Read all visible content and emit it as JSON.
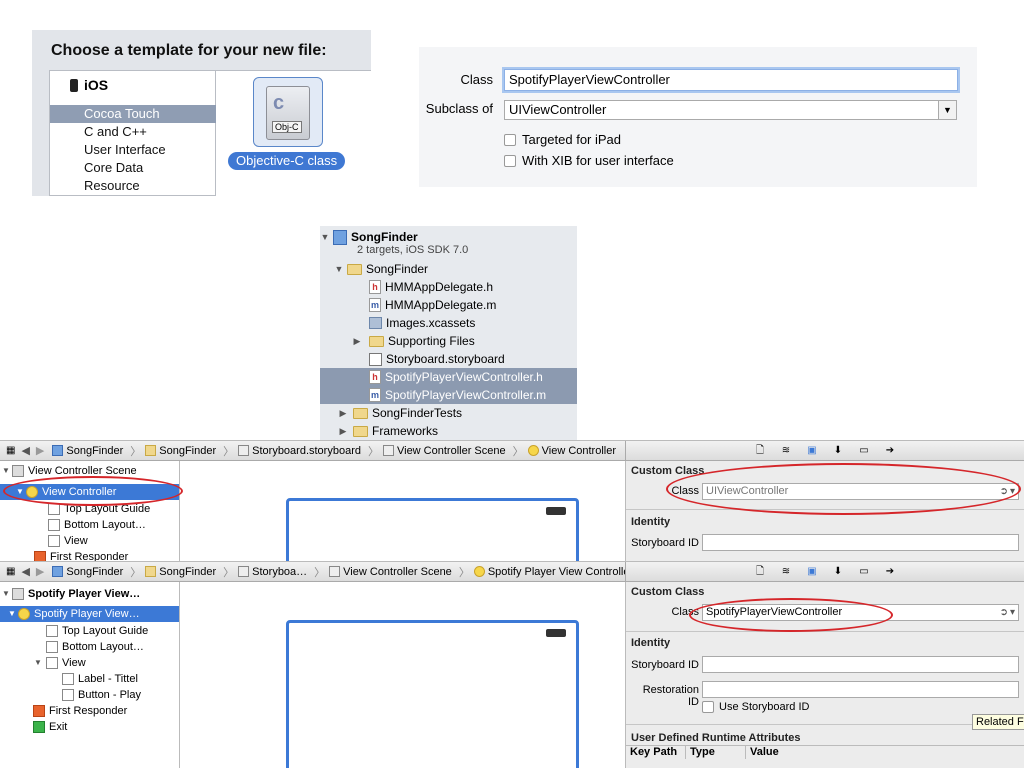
{
  "template_chooser": {
    "title": "Choose a template for your new file:",
    "platform": "iOS",
    "categories": [
      "Cocoa Touch",
      "C and C++",
      "User Interface",
      "Core Data",
      "Resource"
    ],
    "selected_category": "Cocoa Touch",
    "file_icon_badge": "Obj-C",
    "file_icon_letter": "c",
    "selected_template": "Objective-C class"
  },
  "class_options": {
    "class_label": "Class",
    "class_value": "SpotifyPlayerViewController",
    "subclass_label": "Subclass of",
    "subclass_value": "UIViewController",
    "targeted_ipad": "Targeted for iPad",
    "with_xib": "With XIB for user interface"
  },
  "navigator": {
    "project": "SongFinder",
    "project_sub": "2 targets, iOS SDK 7.0",
    "group": "SongFinder",
    "files": [
      "HMMAppDelegate.h",
      "HMMAppDelegate.m",
      "Images.xcassets",
      "Supporting Files",
      "Storyboard.storyboard",
      "SpotifyPlayerViewController.h",
      "SpotifyPlayerViewController.m"
    ],
    "file_badges": [
      "h",
      "m",
      "",
      "",
      "",
      "h",
      "m"
    ],
    "other_groups": [
      "SongFinderTests",
      "Frameworks"
    ]
  },
  "editor1": {
    "breadcrumbs": [
      "SongFinder",
      "SongFinder",
      "Storyboard.storyboard",
      "View Controller Scene",
      "View Controller"
    ],
    "outline": [
      "View Controller Scene",
      "View Controller",
      "Top Layout Guide",
      "Bottom Layout…",
      "View",
      "First Responder"
    ],
    "custom_class_header": "Custom Class",
    "class_label": "Class",
    "class_value": "UIViewController",
    "identity_header": "Identity",
    "storyboard_id_label": "Storyboard ID"
  },
  "editor2": {
    "breadcrumbs": [
      "SongFinder",
      "SongFinder",
      "Storyboa…",
      "View Controller Scene",
      "Spotify Player View Controller"
    ],
    "outline": [
      "Spotify Player View…",
      "Spotify Player View…",
      "Top Layout Guide",
      "Bottom Layout…",
      "View",
      "Label - Tittel",
      "Button - Play",
      "First Responder",
      "Exit"
    ],
    "custom_class_header": "Custom Class",
    "class_label": "Class",
    "class_value": "SpotifyPlayerViewController",
    "identity_header": "Identity",
    "storyboard_id_label": "Storyboard ID",
    "restoration_id_label": "Restoration ID",
    "use_storyboard_id": "Use Storyboard ID",
    "udra_header": "User Defined Runtime Attributes",
    "columns": [
      "Key Path",
      "Type",
      "Value"
    ],
    "related_tooltip": "Related Fil"
  },
  "colors": {
    "selection": "#3c79d6",
    "annotation": "#d5262a"
  }
}
